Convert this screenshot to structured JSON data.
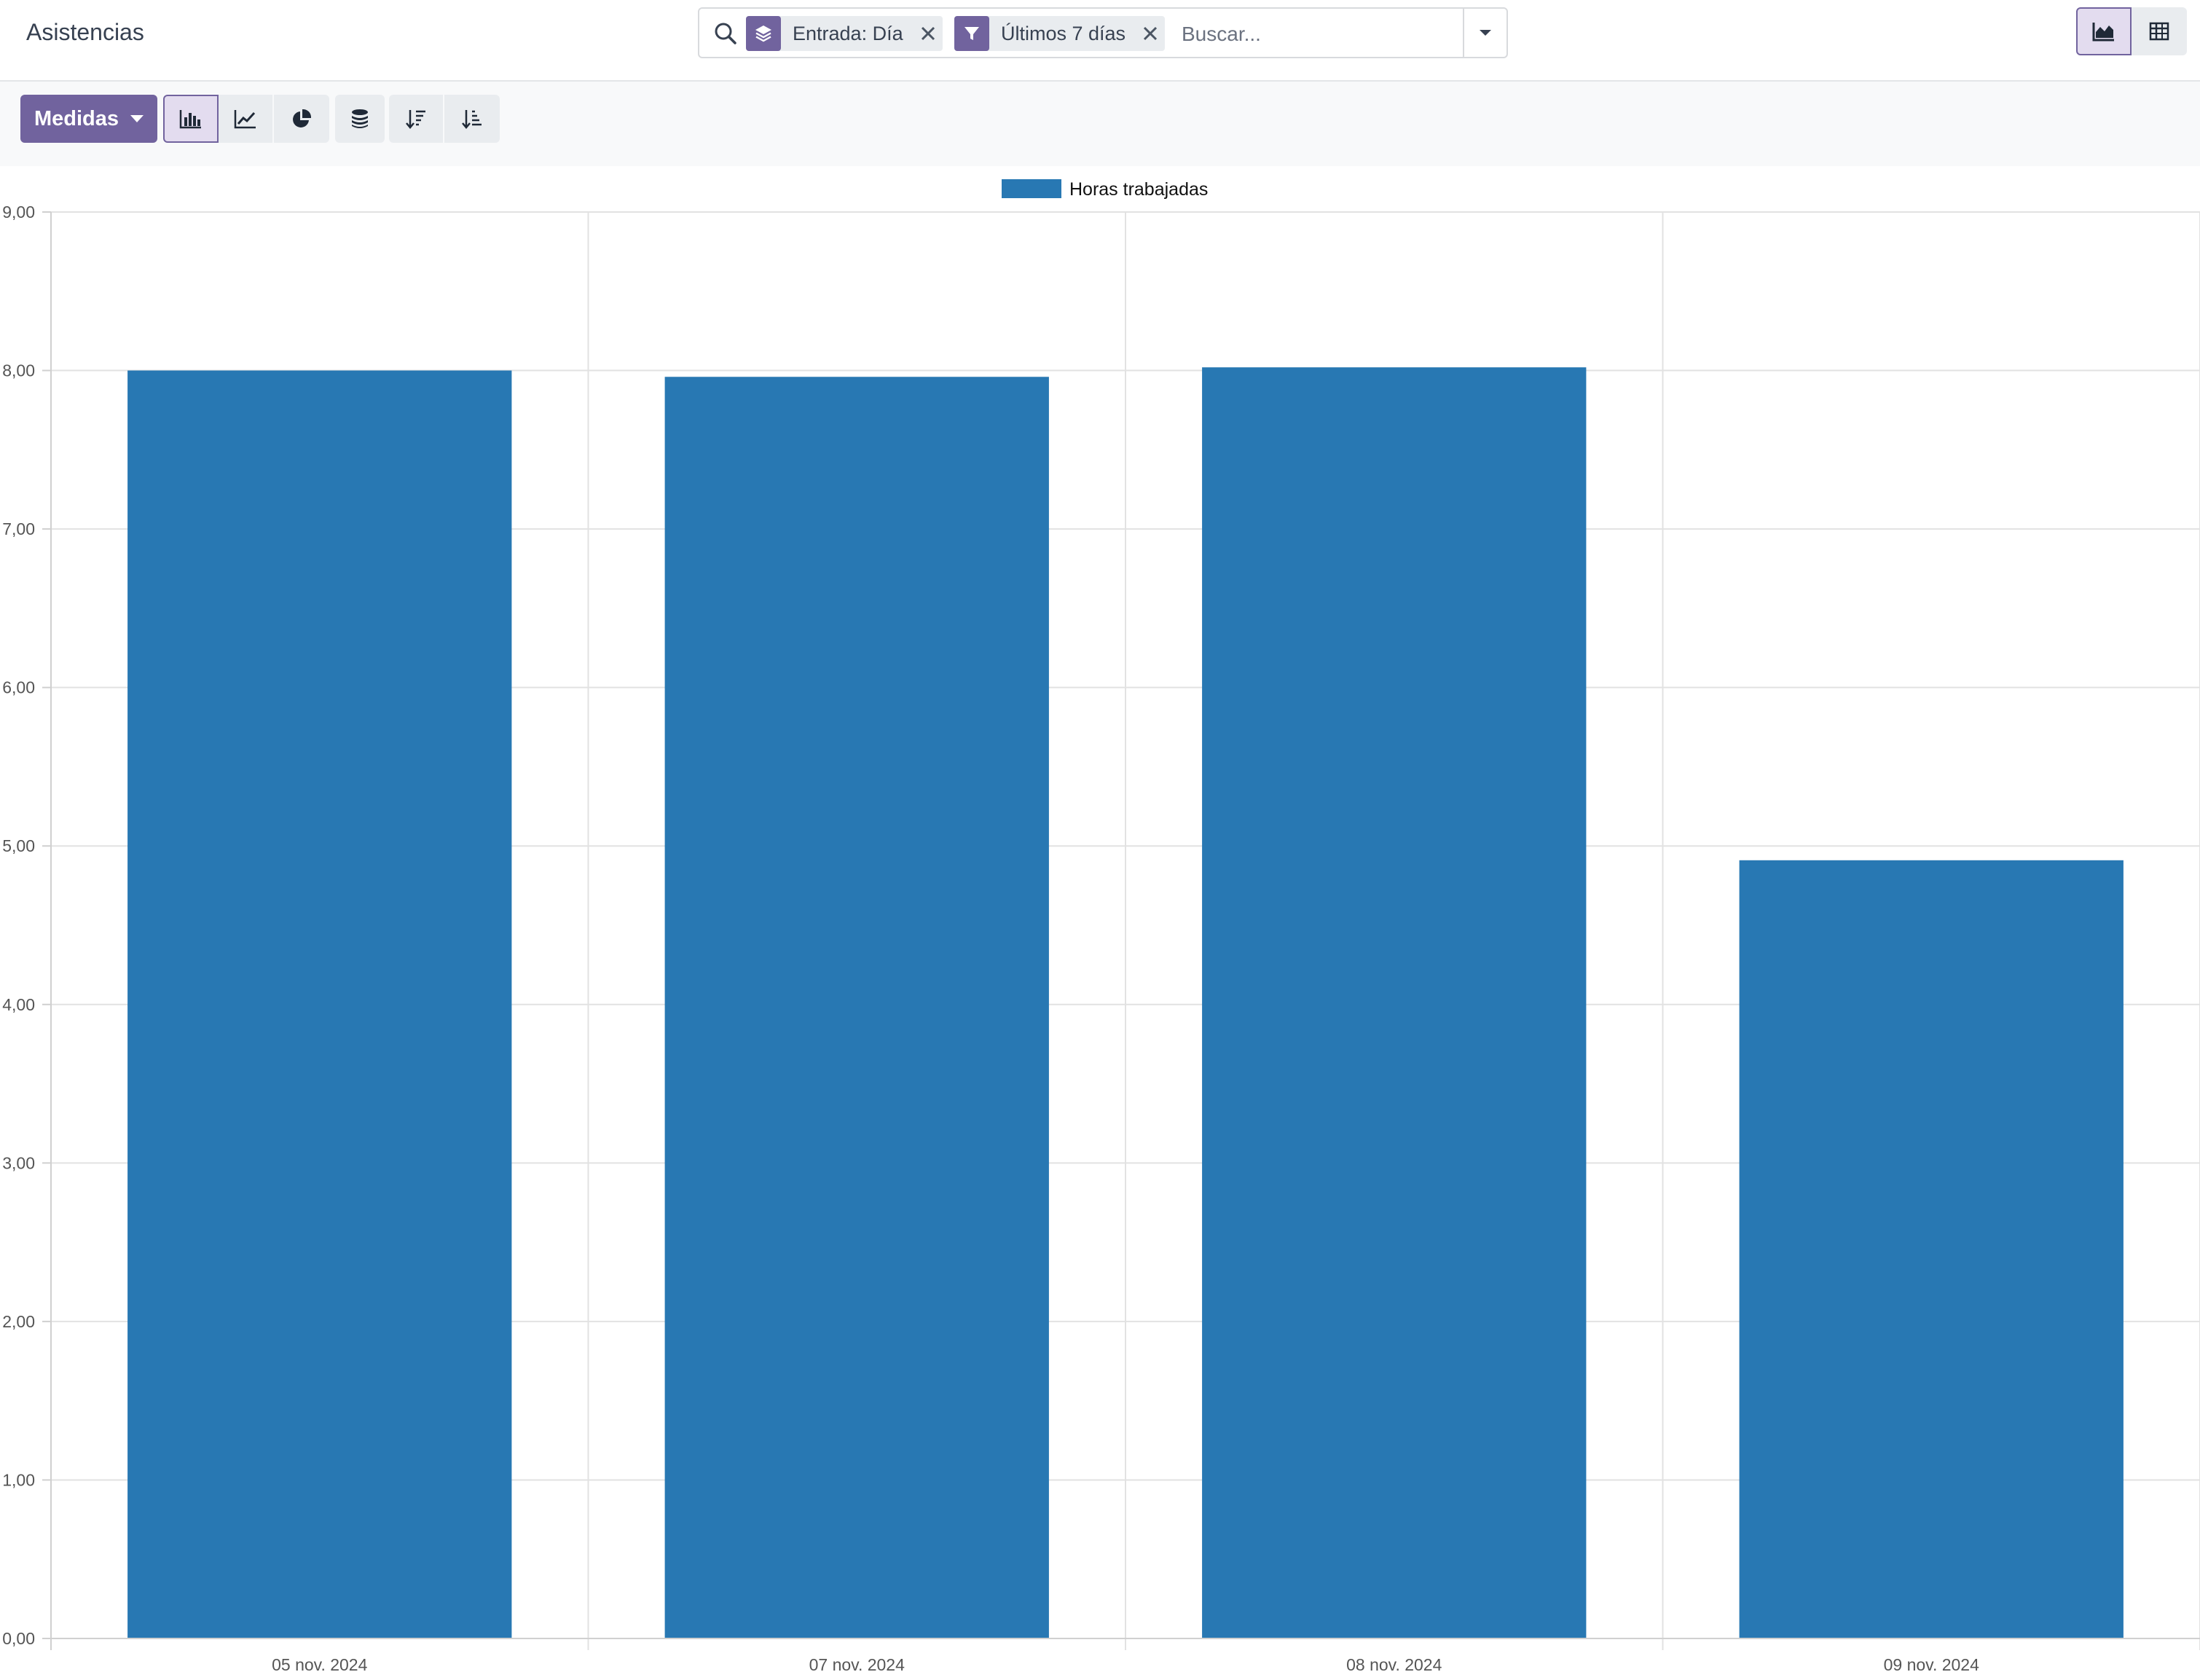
{
  "header": {
    "title": "Asistencias"
  },
  "search": {
    "facets": [
      {
        "icon": "layers-icon",
        "label": "Entrada: Día"
      },
      {
        "icon": "filter-icon",
        "label": "Últimos 7 días"
      }
    ],
    "placeholder": "Buscar..."
  },
  "view_switcher": [
    "graph-view-icon",
    "pivot-view-icon"
  ],
  "toolbar": {
    "measures_label": "Medidas",
    "chart_type_buttons": [
      "bar-chart-icon",
      "line-chart-icon",
      "pie-chart-icon"
    ],
    "stack_button": "stack-icon",
    "sort_buttons": [
      "sort-descending-icon",
      "sort-ascending-icon"
    ]
  },
  "colors": {
    "accent": "#71639e",
    "bar": "#2878b3"
  },
  "chart_data": {
    "type": "bar",
    "categories": [
      "05 nov. 2024",
      "07 nov. 2024",
      "08 nov. 2024",
      "09 nov. 2024"
    ],
    "series": [
      {
        "name": "Horas trabajadas",
        "values": [
          8.0,
          7.96,
          8.02,
          4.91
        ]
      }
    ],
    "ylim": [
      0,
      9
    ],
    "yticks": [
      "0,00",
      "1,00",
      "2,00",
      "3,00",
      "4,00",
      "5,00",
      "6,00",
      "7,00",
      "8,00",
      "9,00"
    ],
    "legend_position": "top-center",
    "grid": true
  }
}
